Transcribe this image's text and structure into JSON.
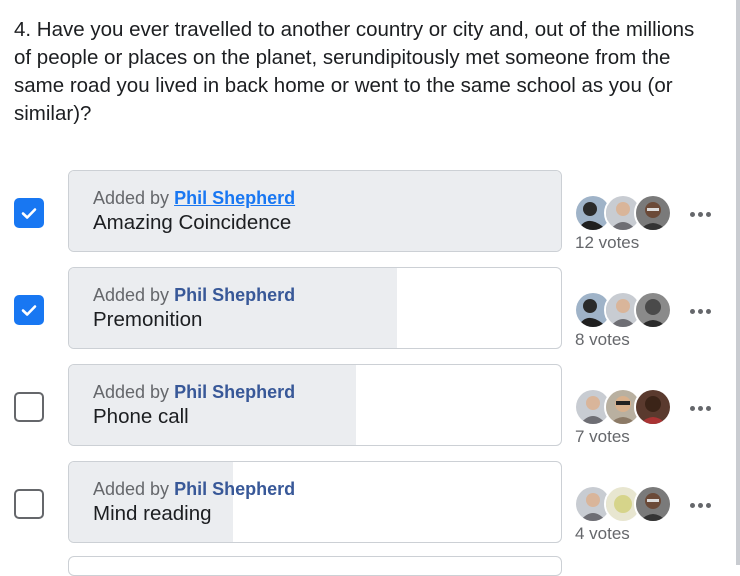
{
  "question": {
    "text": "4. Have you ever travelled to another country or city and, out of the millions of people or places on the planet, serundipitously met someone from the same road you lived in back home or went to the same school as you (or similar)?"
  },
  "options": [
    {
      "added_prefix": "Added by ",
      "author": "Phil Shepherd",
      "label": "Amazing Coincidence",
      "votes_text": "12 votes",
      "checked": true,
      "vote_share": 1.0
    },
    {
      "added_prefix": "Added by ",
      "author": "Phil Shepherd",
      "label": "Premonition",
      "votes_text": "8 votes",
      "checked": true,
      "vote_share": 0.667
    },
    {
      "added_prefix": "Added by ",
      "author": "Phil Shepherd",
      "label": "Phone call",
      "votes_text": "7 votes",
      "checked": false,
      "vote_share": 0.583
    },
    {
      "added_prefix": "Added by ",
      "author": "Phil Shepherd",
      "label": "Mind reading",
      "votes_text": "4 votes",
      "checked": false,
      "vote_share": 0.333
    }
  ],
  "colors": {
    "accent": "#1877f2",
    "fill": "#ebedf0",
    "muted_text": "#65676b"
  },
  "icons": {
    "checkbox_checked": "check-icon",
    "more": "more-options-icon",
    "avatar": "avatar-icon"
  }
}
